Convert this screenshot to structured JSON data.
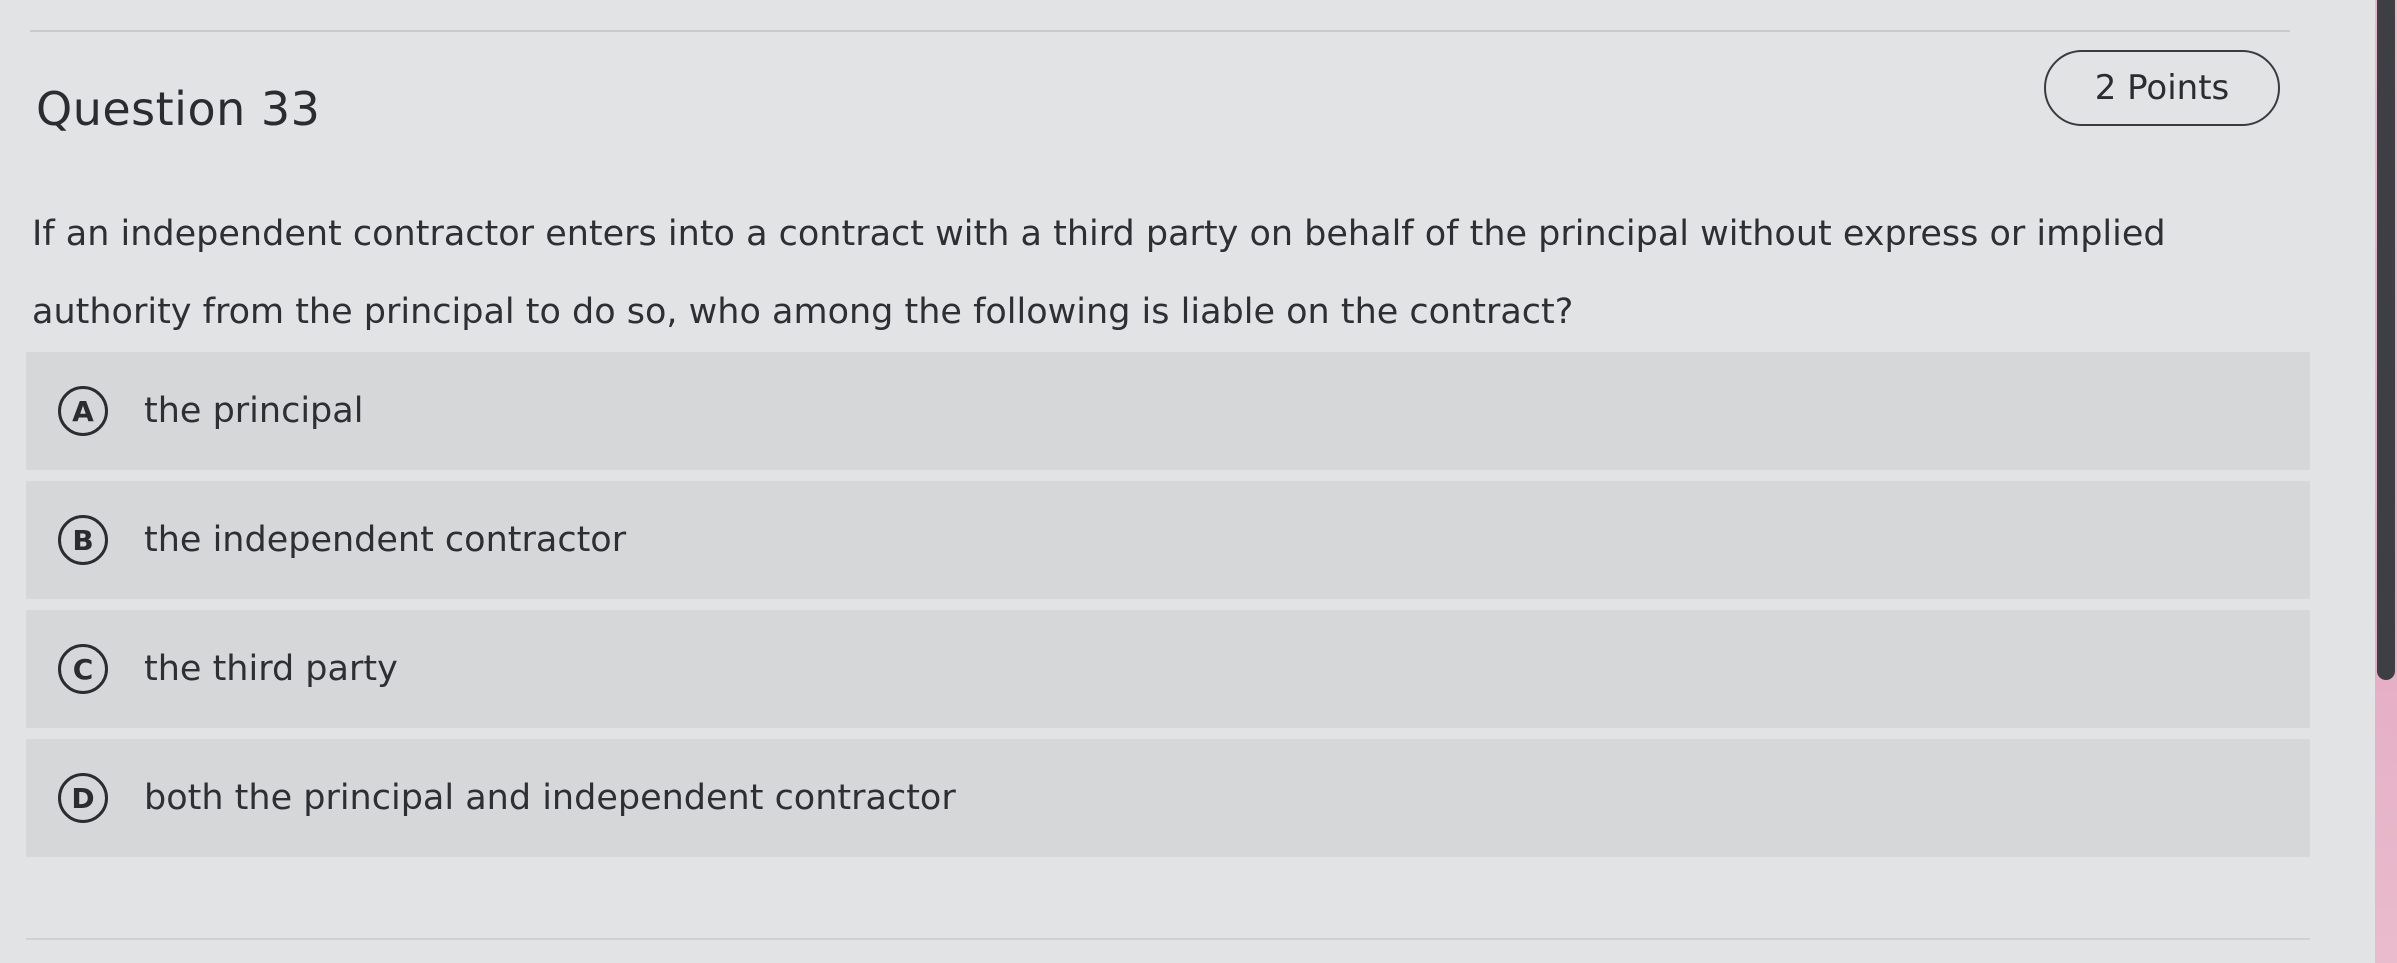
{
  "question": {
    "title": "Question 33",
    "points": "2 Points",
    "text": "If an independent contractor enters into a contract with a third party on behalf of the principal without express or implied authority from the principal to do so, who among the following is liable on the contract?"
  },
  "options": [
    {
      "letter": "A",
      "text": "the principal"
    },
    {
      "letter": "B",
      "text": "the independent contractor"
    },
    {
      "letter": "C",
      "text": "the third party"
    },
    {
      "letter": "D",
      "text": "both the principal and independent contractor"
    }
  ],
  "colors": {
    "page_background": "#e2e3e5",
    "option_background": "#d6d7d9",
    "text": "#2e2f33",
    "scrollbar_thumb": "#3d3f45",
    "scrollbar_track": "#e4aac2"
  }
}
